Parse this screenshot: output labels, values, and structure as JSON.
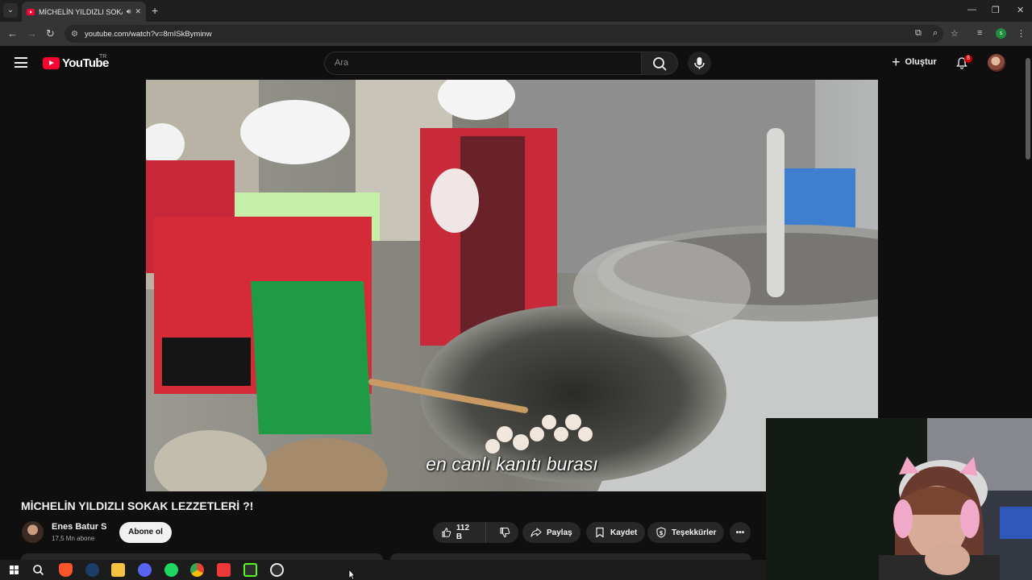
{
  "browser": {
    "tab_title": "MİCHELİN YILDIZLI SOKAK LEZZETLERİ ?!",
    "new_tab_label": "+",
    "url": "youtube.com/watch?v=8mISkByminw",
    "profile_initial": "s"
  },
  "youtube": {
    "logo_text": "YouTube",
    "region": "TR",
    "search_placeholder": "Ara",
    "create_label": "Oluştur",
    "notification_count": "8"
  },
  "video": {
    "subtitle": "en canlı kanıtı burası",
    "title": "MİCHELİN YILDIZLI SOKAK LEZZETLERİ ?!",
    "channel_name": "Enes Batur S",
    "subscriber_count": "17,5 Mn abone",
    "subscribe_label": "Abone ol",
    "likes": "112 B",
    "share_label": "Paylaş",
    "save_label": "Kaydet",
    "thanks_label": "Teşekkürler",
    "more_label": "•••"
  },
  "colors": {
    "yt_red": "#ff0033",
    "background": "#0f0f0f",
    "pill": "#272727",
    "badge": "#cc0000"
  },
  "taskbar": {
    "icons": [
      "windows-start-icon",
      "search-icon",
      "brave-icon",
      "steam-icon",
      "file-explorer-icon",
      "discord-icon",
      "spotify-icon",
      "chrome-icon",
      "vivaldi-icon",
      "app-green-icon",
      "speedometer-icon"
    ]
  }
}
